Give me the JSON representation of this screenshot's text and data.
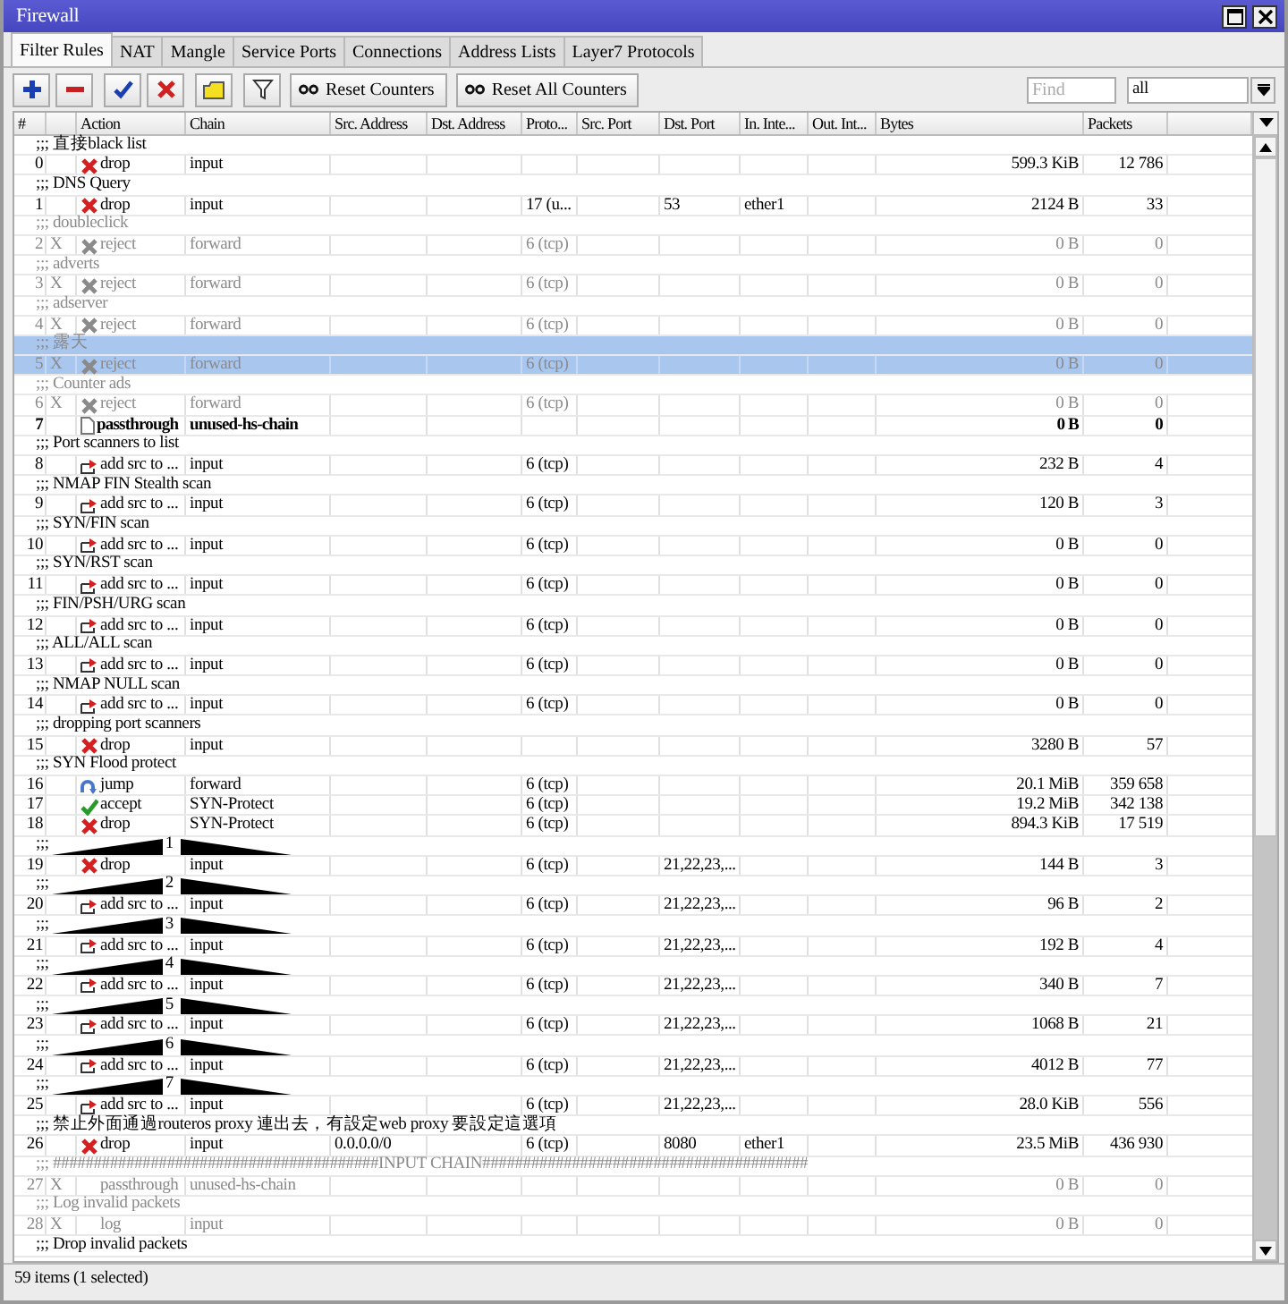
{
  "window": {
    "title": "Firewall"
  },
  "tabs": [
    {
      "label": "Filter Rules",
      "selected": true
    },
    {
      "label": "NAT",
      "selected": false
    },
    {
      "label": "Mangle",
      "selected": false
    },
    {
      "label": "Service Ports",
      "selected": false
    },
    {
      "label": "Connections",
      "selected": false
    },
    {
      "label": "Address Lists",
      "selected": false
    },
    {
      "label": "Layer7 Protocols",
      "selected": false
    }
  ],
  "toolbar": {
    "icon_buttons": [
      {
        "kind": "add"
      },
      {
        "kind": "remove"
      },
      {
        "kind": "enable"
      },
      {
        "kind": "disable"
      },
      {
        "kind": "comment"
      },
      {
        "kind": "filter"
      }
    ],
    "counter_buttons": [
      "Reset Counters",
      "Reset All Counters"
    ],
    "find": {
      "placeholder": "Find"
    },
    "chain_filter": {
      "value": "all"
    }
  },
  "columns": [
    "#",
    "Action",
    "Chain",
    "Src. Address",
    "Dst. Address",
    "Proto...",
    "Src. Port",
    "Dst. Port",
    "In. Inte...",
    "Out. Int...",
    "Bytes",
    "Packets"
  ],
  "lines": [
    {
      "kind": "comment",
      "text": ";;; 直接black list",
      "disabled": false,
      "selected": false
    },
    {
      "kind": "drop",
      "num": "0",
      "action": "drop",
      "chain": "input",
      "bytes": "599.3 KiB",
      "packets": "12 786",
      "disabled": false,
      "selected": false,
      "bold": false
    },
    {
      "kind": "comment",
      "text": ";;; DNS Query",
      "disabled": false,
      "selected": false
    },
    {
      "kind": "drop",
      "num": "1",
      "action": "drop",
      "chain": "input",
      "proto": "17 (u...",
      "dst_port": "53",
      "in_interface": "ether1",
      "bytes": "2124 B",
      "packets": "33",
      "disabled": false,
      "selected": false,
      "bold": false
    },
    {
      "kind": "comment",
      "text": ";;; doubleclick",
      "disabled": true,
      "selected": false
    },
    {
      "kind": "reject",
      "num": "2",
      "flag": "X",
      "action": "reject",
      "chain": "forward",
      "proto": "6 (tcp)",
      "bytes": "0 B",
      "packets": "0",
      "disabled": true,
      "selected": false,
      "bold": false
    },
    {
      "kind": "comment",
      "text": ";;; adverts",
      "disabled": true,
      "selected": false
    },
    {
      "kind": "reject",
      "num": "3",
      "flag": "X",
      "action": "reject",
      "chain": "forward",
      "proto": "6 (tcp)",
      "bytes": "0 B",
      "packets": "0",
      "disabled": true,
      "selected": false,
      "bold": false
    },
    {
      "kind": "comment",
      "text": ";;; adserver",
      "disabled": true,
      "selected": false
    },
    {
      "kind": "reject",
      "num": "4",
      "flag": "X",
      "action": "reject",
      "chain": "forward",
      "proto": "6 (tcp)",
      "bytes": "0 B",
      "packets": "0",
      "disabled": true,
      "selected": false,
      "bold": false
    },
    {
      "kind": "comment",
      "text": ";;; 露天",
      "disabled": true,
      "selected": true
    },
    {
      "kind": "reject",
      "num": "5",
      "flag": "X",
      "action": "reject",
      "chain": "forward",
      "proto": "6 (tcp)",
      "bytes": "0 B",
      "packets": "0",
      "disabled": true,
      "selected": true,
      "bold": false
    },
    {
      "kind": "comment",
      "text": ";;; Counter ads",
      "disabled": true,
      "selected": false
    },
    {
      "kind": "reject",
      "num": "6",
      "flag": "X",
      "action": "reject",
      "chain": "forward",
      "proto": "6 (tcp)",
      "bytes": "0 B",
      "packets": "0",
      "disabled": true,
      "selected": false,
      "bold": false
    },
    {
      "kind": "passthrough",
      "num": "7",
      "action": "passthrough",
      "chain": "unused-hs-chain",
      "bytes": "0 B",
      "packets": "0",
      "disabled": false,
      "selected": false,
      "bold": true
    },
    {
      "kind": "comment",
      "text": ";;; Port scanners to list",
      "disabled": false,
      "selected": false
    },
    {
      "kind": "add_src",
      "num": "8",
      "action": "add src to ...",
      "chain": "input",
      "proto": "6 (tcp)",
      "bytes": "232 B",
      "packets": "4",
      "disabled": false,
      "selected": false,
      "bold": false
    },
    {
      "kind": "comment",
      "text": ";;; NMAP FIN Stealth scan",
      "disabled": false,
      "selected": false
    },
    {
      "kind": "add_src",
      "num": "9",
      "action": "add src to ...",
      "chain": "input",
      "proto": "6 (tcp)",
      "bytes": "120 B",
      "packets": "3",
      "disabled": false,
      "selected": false,
      "bold": false
    },
    {
      "kind": "comment",
      "text": ";;; SYN/FIN scan",
      "disabled": false,
      "selected": false
    },
    {
      "kind": "add_src",
      "num": "10",
      "action": "add src to ...",
      "chain": "input",
      "proto": "6 (tcp)",
      "bytes": "0 B",
      "packets": "0",
      "disabled": false,
      "selected": false,
      "bold": false
    },
    {
      "kind": "comment",
      "text": ";;; SYN/RST scan",
      "disabled": false,
      "selected": false
    },
    {
      "kind": "add_src",
      "num": "11",
      "action": "add src to ...",
      "chain": "input",
      "proto": "6 (tcp)",
      "bytes": "0 B",
      "packets": "0",
      "disabled": false,
      "selected": false,
      "bold": false
    },
    {
      "kind": "comment",
      "text": ";;; FIN/PSH/URG scan",
      "disabled": false,
      "selected": false
    },
    {
      "kind": "add_src",
      "num": "12",
      "action": "add src to ...",
      "chain": "input",
      "proto": "6 (tcp)",
      "bytes": "0 B",
      "packets": "0",
      "disabled": false,
      "selected": false,
      "bold": false
    },
    {
      "kind": "comment",
      "text": ";;; ALL/ALL scan",
      "disabled": false,
      "selected": false
    },
    {
      "kind": "add_src",
      "num": "13",
      "action": "add src to ...",
      "chain": "input",
      "proto": "6 (tcp)",
      "bytes": "0 B",
      "packets": "0",
      "disabled": false,
      "selected": false,
      "bold": false
    },
    {
      "kind": "comment",
      "text": ";;; NMAP NULL scan",
      "disabled": false,
      "selected": false
    },
    {
      "kind": "add_src",
      "num": "14",
      "action": "add src to ...",
      "chain": "input",
      "proto": "6 (tcp)",
      "bytes": "0 B",
      "packets": "0",
      "disabled": false,
      "selected": false,
      "bold": false
    },
    {
      "kind": "comment",
      "text": ";;; dropping port scanners",
      "disabled": false,
      "selected": false
    },
    {
      "kind": "drop",
      "num": "15",
      "action": "drop",
      "chain": "input",
      "bytes": "3280 B",
      "packets": "57",
      "disabled": false,
      "selected": false,
      "bold": false
    },
    {
      "kind": "comment",
      "text": ";;; SYN Flood protect",
      "disabled": false,
      "selected": false
    },
    {
      "kind": "jump",
      "num": "16",
      "action": "jump",
      "chain": "forward",
      "proto": "6 (tcp)",
      "bytes": "20.1 MiB",
      "packets": "359 658",
      "disabled": false,
      "selected": false,
      "bold": false
    },
    {
      "kind": "accept",
      "num": "17",
      "action": "accept",
      "chain": "SYN-Protect",
      "proto": "6 (tcp)",
      "bytes": "19.2 MiB",
      "packets": "342 138",
      "disabled": false,
      "selected": false,
      "bold": false
    },
    {
      "kind": "drop",
      "num": "18",
      "action": "drop",
      "chain": "SYN-Protect",
      "proto": "6 (tcp)",
      "bytes": "894.3 KiB",
      "packets": "17 519",
      "disabled": false,
      "selected": false,
      "bold": false
    },
    {
      "kind": "ramp_comment",
      "prefix": ";;;",
      "label": "1",
      "disabled": false,
      "selected": false
    },
    {
      "kind": "drop",
      "num": "19",
      "action": "drop",
      "chain": "input",
      "proto": "6 (tcp)",
      "dst_port": "21,22,23,...",
      "bytes": "144 B",
      "packets": "3",
      "disabled": false,
      "selected": false,
      "bold": false
    },
    {
      "kind": "ramp_comment",
      "prefix": ";;;",
      "label": "2",
      "disabled": false,
      "selected": false
    },
    {
      "kind": "add_src",
      "num": "20",
      "action": "add src to ...",
      "chain": "input",
      "proto": "6 (tcp)",
      "dst_port": "21,22,23,...",
      "bytes": "96 B",
      "packets": "2",
      "disabled": false,
      "selected": false,
      "bold": false
    },
    {
      "kind": "ramp_comment",
      "prefix": ";;;",
      "label": "3",
      "disabled": false,
      "selected": false
    },
    {
      "kind": "add_src",
      "num": "21",
      "action": "add src to ...",
      "chain": "input",
      "proto": "6 (tcp)",
      "dst_port": "21,22,23,...",
      "bytes": "192 B",
      "packets": "4",
      "disabled": false,
      "selected": false,
      "bold": false
    },
    {
      "kind": "ramp_comment",
      "prefix": ";;;",
      "label": "4",
      "disabled": false,
      "selected": false
    },
    {
      "kind": "add_src",
      "num": "22",
      "action": "add src to ...",
      "chain": "input",
      "proto": "6 (tcp)",
      "dst_port": "21,22,23,...",
      "bytes": "340 B",
      "packets": "7",
      "disabled": false,
      "selected": false,
      "bold": false
    },
    {
      "kind": "ramp_comment",
      "prefix": ";;;",
      "label": "5",
      "disabled": false,
      "selected": false
    },
    {
      "kind": "add_src",
      "num": "23",
      "action": "add src to ...",
      "chain": "input",
      "proto": "6 (tcp)",
      "dst_port": "21,22,23,...",
      "bytes": "1068 B",
      "packets": "21",
      "disabled": false,
      "selected": false,
      "bold": false
    },
    {
      "kind": "ramp_comment",
      "prefix": ";;;",
      "label": "6",
      "disabled": false,
      "selected": false
    },
    {
      "kind": "add_src",
      "num": "24",
      "action": "add src to ...",
      "chain": "input",
      "proto": "6 (tcp)",
      "dst_port": "21,22,23,...",
      "bytes": "4012 B",
      "packets": "77",
      "disabled": false,
      "selected": false,
      "bold": false
    },
    {
      "kind": "ramp_comment",
      "prefix": ";;;",
      "label": "7",
      "disabled": false,
      "selected": false
    },
    {
      "kind": "add_src",
      "num": "25",
      "action": "add src to ...",
      "chain": "input",
      "proto": "6 (tcp)",
      "dst_port": "21,22,23,...",
      "bytes": "28.0 KiB",
      "packets": "556",
      "disabled": false,
      "selected": false,
      "bold": false
    },
    {
      "kind": "comment",
      "text": ";;; 禁止外面通過routeros proxy 連出去，有設定web proxy 要設定這選項",
      "disabled": false,
      "selected": false
    },
    {
      "kind": "drop",
      "num": "26",
      "action": "drop",
      "chain": "input",
      "src_address": "0.0.0.0/0",
      "proto": "6 (tcp)",
      "dst_port": "8080",
      "in_interface": "ether1",
      "bytes": "23.5 MiB",
      "packets": "436 930",
      "disabled": false,
      "selected": false,
      "bold": false
    },
    {
      "kind": "comment",
      "text": ";;; ########################################INPUT CHAIN########################################",
      "disabled": true,
      "selected": false
    },
    {
      "kind": "plain",
      "num": "27",
      "flag": "X",
      "action": "passthrough",
      "chain": "unused-hs-chain",
      "bytes": "0 B",
      "packets": "0",
      "disabled": true,
      "selected": false,
      "bold": false
    },
    {
      "kind": "comment",
      "text": ";;; Log invalid packets",
      "disabled": true,
      "selected": false
    },
    {
      "kind": "plain",
      "num": "28",
      "flag": "X",
      "action": "log",
      "chain": "input",
      "bytes": "0 B",
      "packets": "0",
      "disabled": true,
      "selected": false,
      "bold": false
    },
    {
      "kind": "comment",
      "text": ";;; Drop invalid packets",
      "disabled": false,
      "selected": false
    }
  ],
  "status_bar": "59 items (1 selected)"
}
